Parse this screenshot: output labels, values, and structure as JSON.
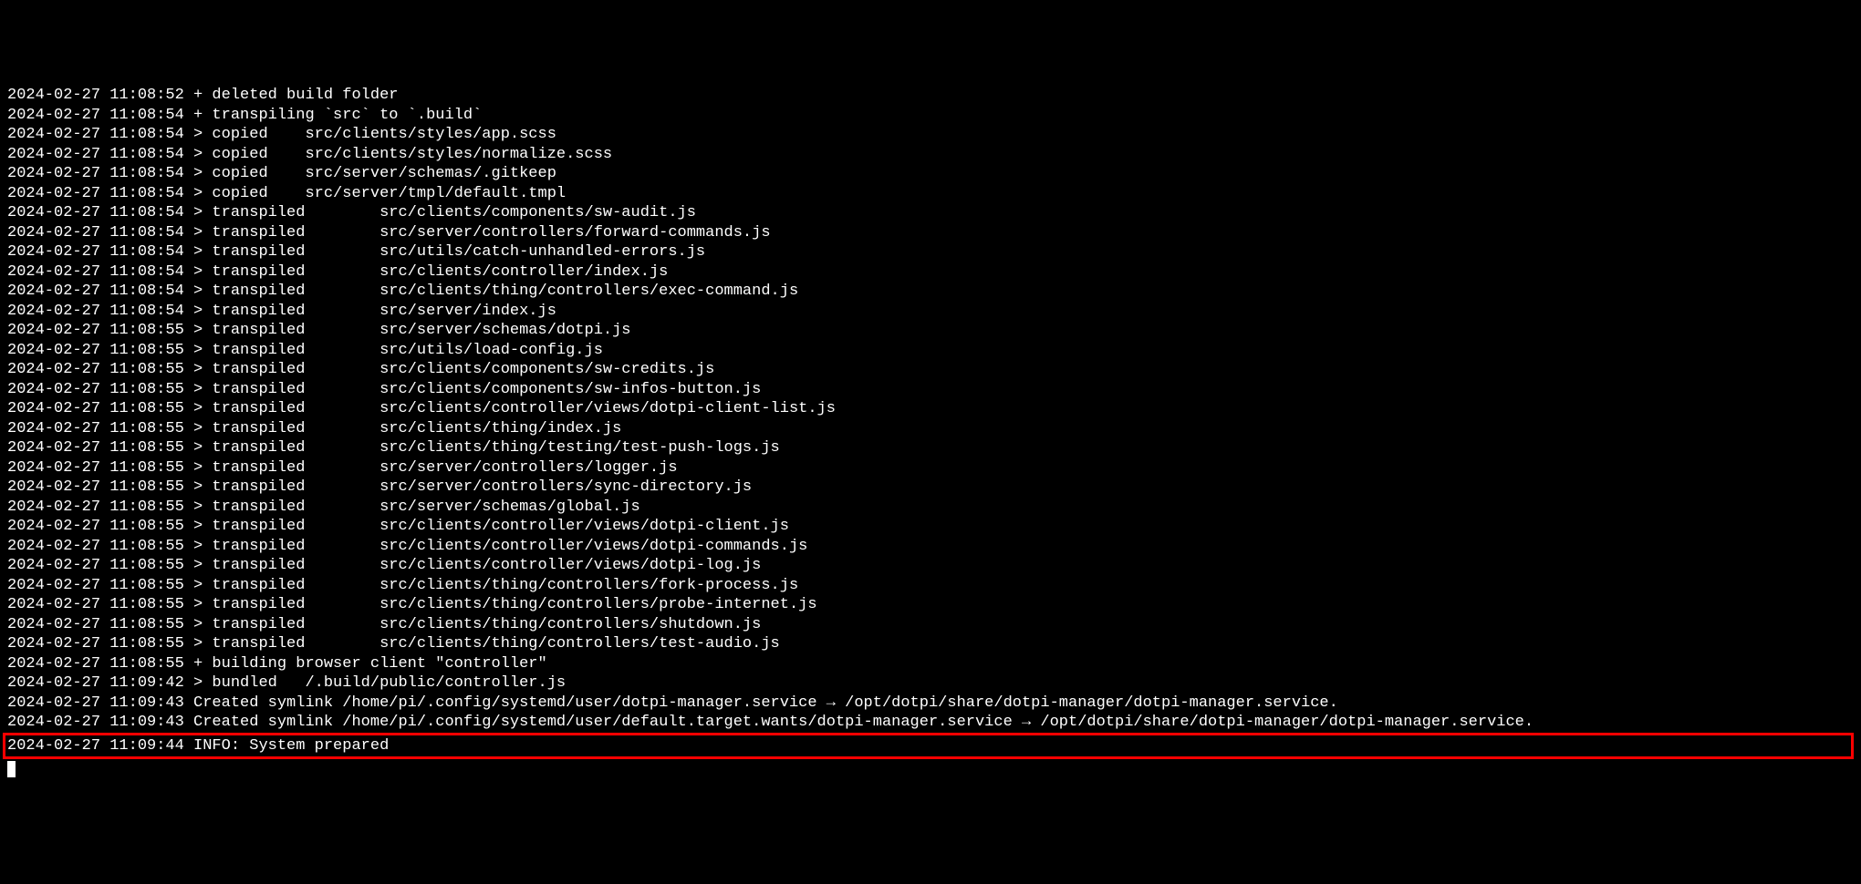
{
  "terminal": {
    "lines": [
      "2024-02-27 11:08:52 + deleted build folder",
      "2024-02-27 11:08:54 + transpiling `src` to `.build`",
      "2024-02-27 11:08:54 > copied    src/clients/styles/app.scss",
      "2024-02-27 11:08:54 > copied    src/clients/styles/normalize.scss",
      "2024-02-27 11:08:54 > copied    src/server/schemas/.gitkeep",
      "2024-02-27 11:08:54 > copied    src/server/tmpl/default.tmpl",
      "2024-02-27 11:08:54 > transpiled        src/clients/components/sw-audit.js",
      "2024-02-27 11:08:54 > transpiled        src/server/controllers/forward-commands.js",
      "2024-02-27 11:08:54 > transpiled        src/utils/catch-unhandled-errors.js",
      "2024-02-27 11:08:54 > transpiled        src/clients/controller/index.js",
      "2024-02-27 11:08:54 > transpiled        src/clients/thing/controllers/exec-command.js",
      "2024-02-27 11:08:54 > transpiled        src/server/index.js",
      "2024-02-27 11:08:55 > transpiled        src/server/schemas/dotpi.js",
      "2024-02-27 11:08:55 > transpiled        src/utils/load-config.js",
      "2024-02-27 11:08:55 > transpiled        src/clients/components/sw-credits.js",
      "2024-02-27 11:08:55 > transpiled        src/clients/components/sw-infos-button.js",
      "2024-02-27 11:08:55 > transpiled        src/clients/controller/views/dotpi-client-list.js",
      "2024-02-27 11:08:55 > transpiled        src/clients/thing/index.js",
      "2024-02-27 11:08:55 > transpiled        src/clients/thing/testing/test-push-logs.js",
      "2024-02-27 11:08:55 > transpiled        src/server/controllers/logger.js",
      "2024-02-27 11:08:55 > transpiled        src/server/controllers/sync-directory.js",
      "2024-02-27 11:08:55 > transpiled        src/server/schemas/global.js",
      "2024-02-27 11:08:55 > transpiled        src/clients/controller/views/dotpi-client.js",
      "2024-02-27 11:08:55 > transpiled        src/clients/controller/views/dotpi-commands.js",
      "2024-02-27 11:08:55 > transpiled        src/clients/controller/views/dotpi-log.js",
      "2024-02-27 11:08:55 > transpiled        src/clients/thing/controllers/fork-process.js",
      "2024-02-27 11:08:55 > transpiled        src/clients/thing/controllers/probe-internet.js",
      "2024-02-27 11:08:55 > transpiled        src/clients/thing/controllers/shutdown.js",
      "2024-02-27 11:08:55 > transpiled        src/clients/thing/controllers/test-audio.js",
      "2024-02-27 11:08:55 + building browser client \"controller\"",
      "2024-02-27 11:09:42 > bundled   /.build/public/controller.js",
      "2024-02-27 11:09:43 Created symlink /home/pi/.config/systemd/user/dotpi-manager.service → /opt/dotpi/share/dotpi-manager/dotpi-manager.service.",
      "2024-02-27 11:09:43 Created symlink /home/pi/.config/systemd/user/default.target.wants/dotpi-manager.service → /opt/dotpi/share/dotpi-manager/dotpi-manager.service."
    ],
    "highlighted_line": "2024-02-27 11:09:44 INFO: System prepared"
  }
}
